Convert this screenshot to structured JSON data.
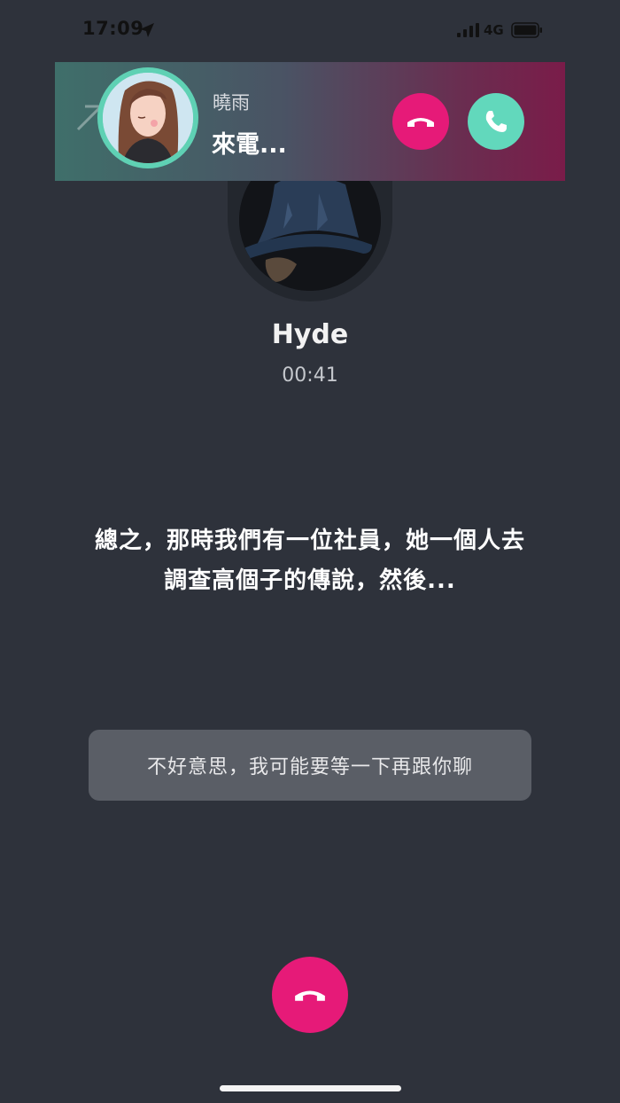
{
  "status_bar": {
    "time": "17:09",
    "network": "4G",
    "icons": [
      "location-arrow-icon",
      "signal-bars-icon",
      "battery-icon"
    ]
  },
  "incoming_call": {
    "caller_name": "曉雨",
    "status_text": "來電...",
    "decline_icon": "phone-hangup-icon",
    "accept_icon": "phone-accept-icon",
    "colors": {
      "decline": "#e61a78",
      "accept": "#62d8bc",
      "avatar_ring": "#5fd1b4"
    }
  },
  "active_call": {
    "contact_name": "Hyde",
    "duration": "00:41",
    "transcript_lines": [
      "總之，那時我們有一位社員，她一個人去",
      "調查高個子的傳說，然後..."
    ],
    "reply_option": "不好意思，我可能要等一下再跟你聊",
    "hangup_icon": "phone-hangup-icon",
    "colors": {
      "background": "#2e323b",
      "hangup": "#e61a78"
    }
  }
}
